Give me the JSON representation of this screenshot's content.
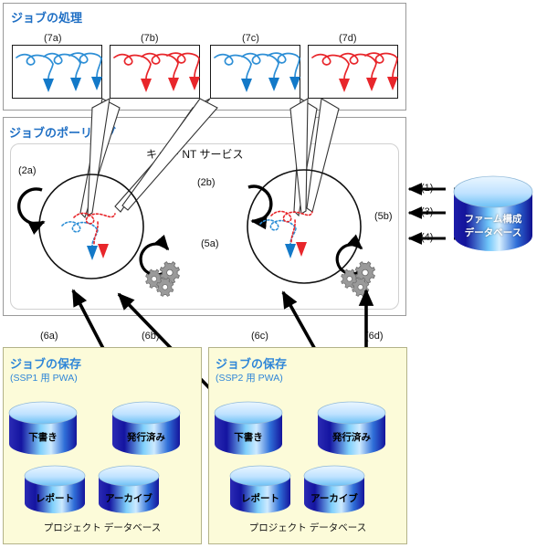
{
  "panels": {
    "processing": {
      "title": "ジョブの処理"
    },
    "polling": {
      "title": "ジョブのポーリング",
      "service_label": "キュー NT サービス"
    },
    "storage_left": {
      "title": "ジョブの保存",
      "subtitle": "(SSP1 用 PWA)",
      "db_caption": "プロジェクト データベース"
    },
    "storage_right": {
      "title": "ジョブの保存",
      "subtitle": "(SSP2 用 PWA)",
      "db_caption": "プロジェクト データベース"
    }
  },
  "job_boxes": [
    {
      "label": "(7a)",
      "color": "#2e8fd6"
    },
    {
      "label": "(7b)",
      "color": "#e8262b"
    },
    {
      "label": "(7c)",
      "color": "#2e8fd6"
    },
    {
      "label": "(7d)",
      "color": "#e8262b"
    }
  ],
  "queue_loops": [
    {
      "label": "(2a)"
    },
    {
      "label": "(2b)"
    },
    {
      "label": "(5a)"
    },
    {
      "label": "(5b)"
    }
  ],
  "farm_db": {
    "line1": "ファーム構成",
    "line2": "データベース",
    "arrows": [
      {
        "label": "(1)"
      },
      {
        "label": "(3)"
      },
      {
        "label": "(4)"
      }
    ]
  },
  "storage_arrows": [
    {
      "label": "(6a)"
    },
    {
      "label": "(6b)"
    },
    {
      "label": "(6c)"
    },
    {
      "label": "(6d)"
    }
  ],
  "cylinders_left": [
    {
      "label": "下書き"
    },
    {
      "label": "発行済み"
    },
    {
      "label": "レポート"
    },
    {
      "label": "アーカイブ"
    }
  ],
  "cylinders_right": [
    {
      "label": "下書き"
    },
    {
      "label": "発行済み"
    },
    {
      "label": "レポート"
    },
    {
      "label": "アーカイブ"
    }
  ],
  "colors": {
    "title_blue": "#1f6fc4",
    "yellow_bg": "#fcfbd9",
    "blue_job": "#2e8fd6",
    "red_job": "#e8262b",
    "db_blue_dark": "#1414a0",
    "db_blue_light": "#bfe4ff"
  }
}
